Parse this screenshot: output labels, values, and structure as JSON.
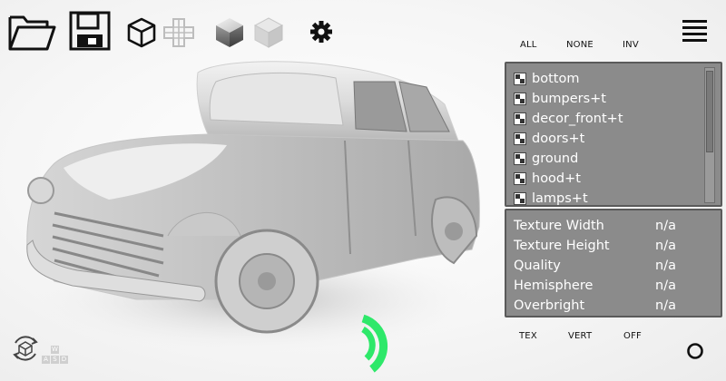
{
  "select": {
    "all": "ALL",
    "none": "NONE",
    "inv": "INV"
  },
  "layers": [
    "bottom",
    "bumpers+t",
    "decor_front+t",
    "doors+t",
    "ground",
    "hood+t",
    "lamps+t"
  ],
  "info": [
    {
      "label": "Texture Width",
      "value": "n/a"
    },
    {
      "label": "Texture Height",
      "value": "n/a"
    },
    {
      "label": "Quality",
      "value": "n/a"
    },
    {
      "label": "Hemisphere",
      "value": "n/a"
    },
    {
      "label": "Overbright",
      "value": "n/a"
    }
  ],
  "modes": {
    "tex": "TEX",
    "vert": "VERT",
    "off": "OFF"
  },
  "keys": {
    "w": "W",
    "a": "A",
    "s": "S",
    "d": "D"
  },
  "icons": {
    "open": "folder-open-icon",
    "save": "floppy-disk-icon",
    "wire": "cube-wireframe-icon",
    "cross": "cross-outline-icon",
    "solid": "cube-solid-icon",
    "light": "cube-light-icon",
    "settings": "gear-icon",
    "menu": "hamburger-icon",
    "rotate": "rotate-view-icon",
    "record": "circle-icon",
    "loader": "loading-arc-icon"
  },
  "colors": {
    "panel_bg": "#8b8b8b",
    "panel_border": "#5a5a5a",
    "loader": "#2ee86a",
    "text": "#ffffff"
  }
}
